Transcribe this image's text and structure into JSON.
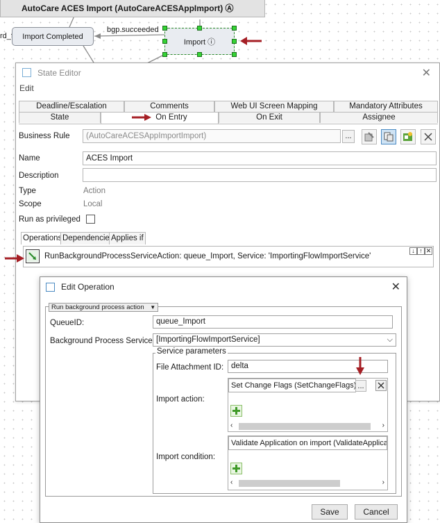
{
  "workflow": {
    "title": "AutoCare ACES Import (AutoCareACESAppImport) Ⓐ",
    "edge_partial_label": "rd_file",
    "node_completed": "Import Completed",
    "edge_label": "bgp.succeeded",
    "node_import": "Import ⓘ"
  },
  "state_editor": {
    "title": "State Editor",
    "menu": "Edit",
    "tabs_top": [
      "Deadline/Escalation",
      "Comments",
      "Web UI Screen Mapping",
      "Mandatory Attributes"
    ],
    "tabs_bottom": [
      "State",
      "On Entry",
      "On Exit",
      "Assignee"
    ],
    "business_rule_label": "Business Rule",
    "business_rule_value": "(AutoCareACESAppImportImport)",
    "ellipsis": "...",
    "name_label": "Name",
    "name_value": "ACES Import",
    "description_label": "Description",
    "type_label": "Type",
    "type_value": "Action",
    "scope_label": "Scope",
    "scope_value": "Local",
    "privileged_label": "Run as privileged",
    "subtabs": [
      "Operations",
      "Dependencies",
      "Applies if"
    ],
    "operation_text": "RunBackgroundProcessServiceAction: queue_Import, Service: 'ImportingFlowImportService'"
  },
  "edit_operation": {
    "title": "Edit Operation",
    "action_type": "Run background process action",
    "queue_label": "QueueID:",
    "queue_value": "queue_Import",
    "service_label": "Background Process Service:",
    "service_value": "[ImportingFlowImportService]",
    "params_label": "Service parameters",
    "file_attachment_label": "File Attachment ID:",
    "file_attachment_value": "delta",
    "import_action_label": "Import action:",
    "import_action_value": "Set Change Flags (SetChangeFlags)",
    "import_condition_label": "Import condition:",
    "import_condition_value": "Validate Application on import (ValidateApplicati",
    "ellipsis": "...",
    "save": "Save",
    "cancel": "Cancel"
  },
  "colors": {
    "red_arrow": "#a51f25",
    "handle_green": "#35d435",
    "icon_blue": "#7aaed6"
  }
}
